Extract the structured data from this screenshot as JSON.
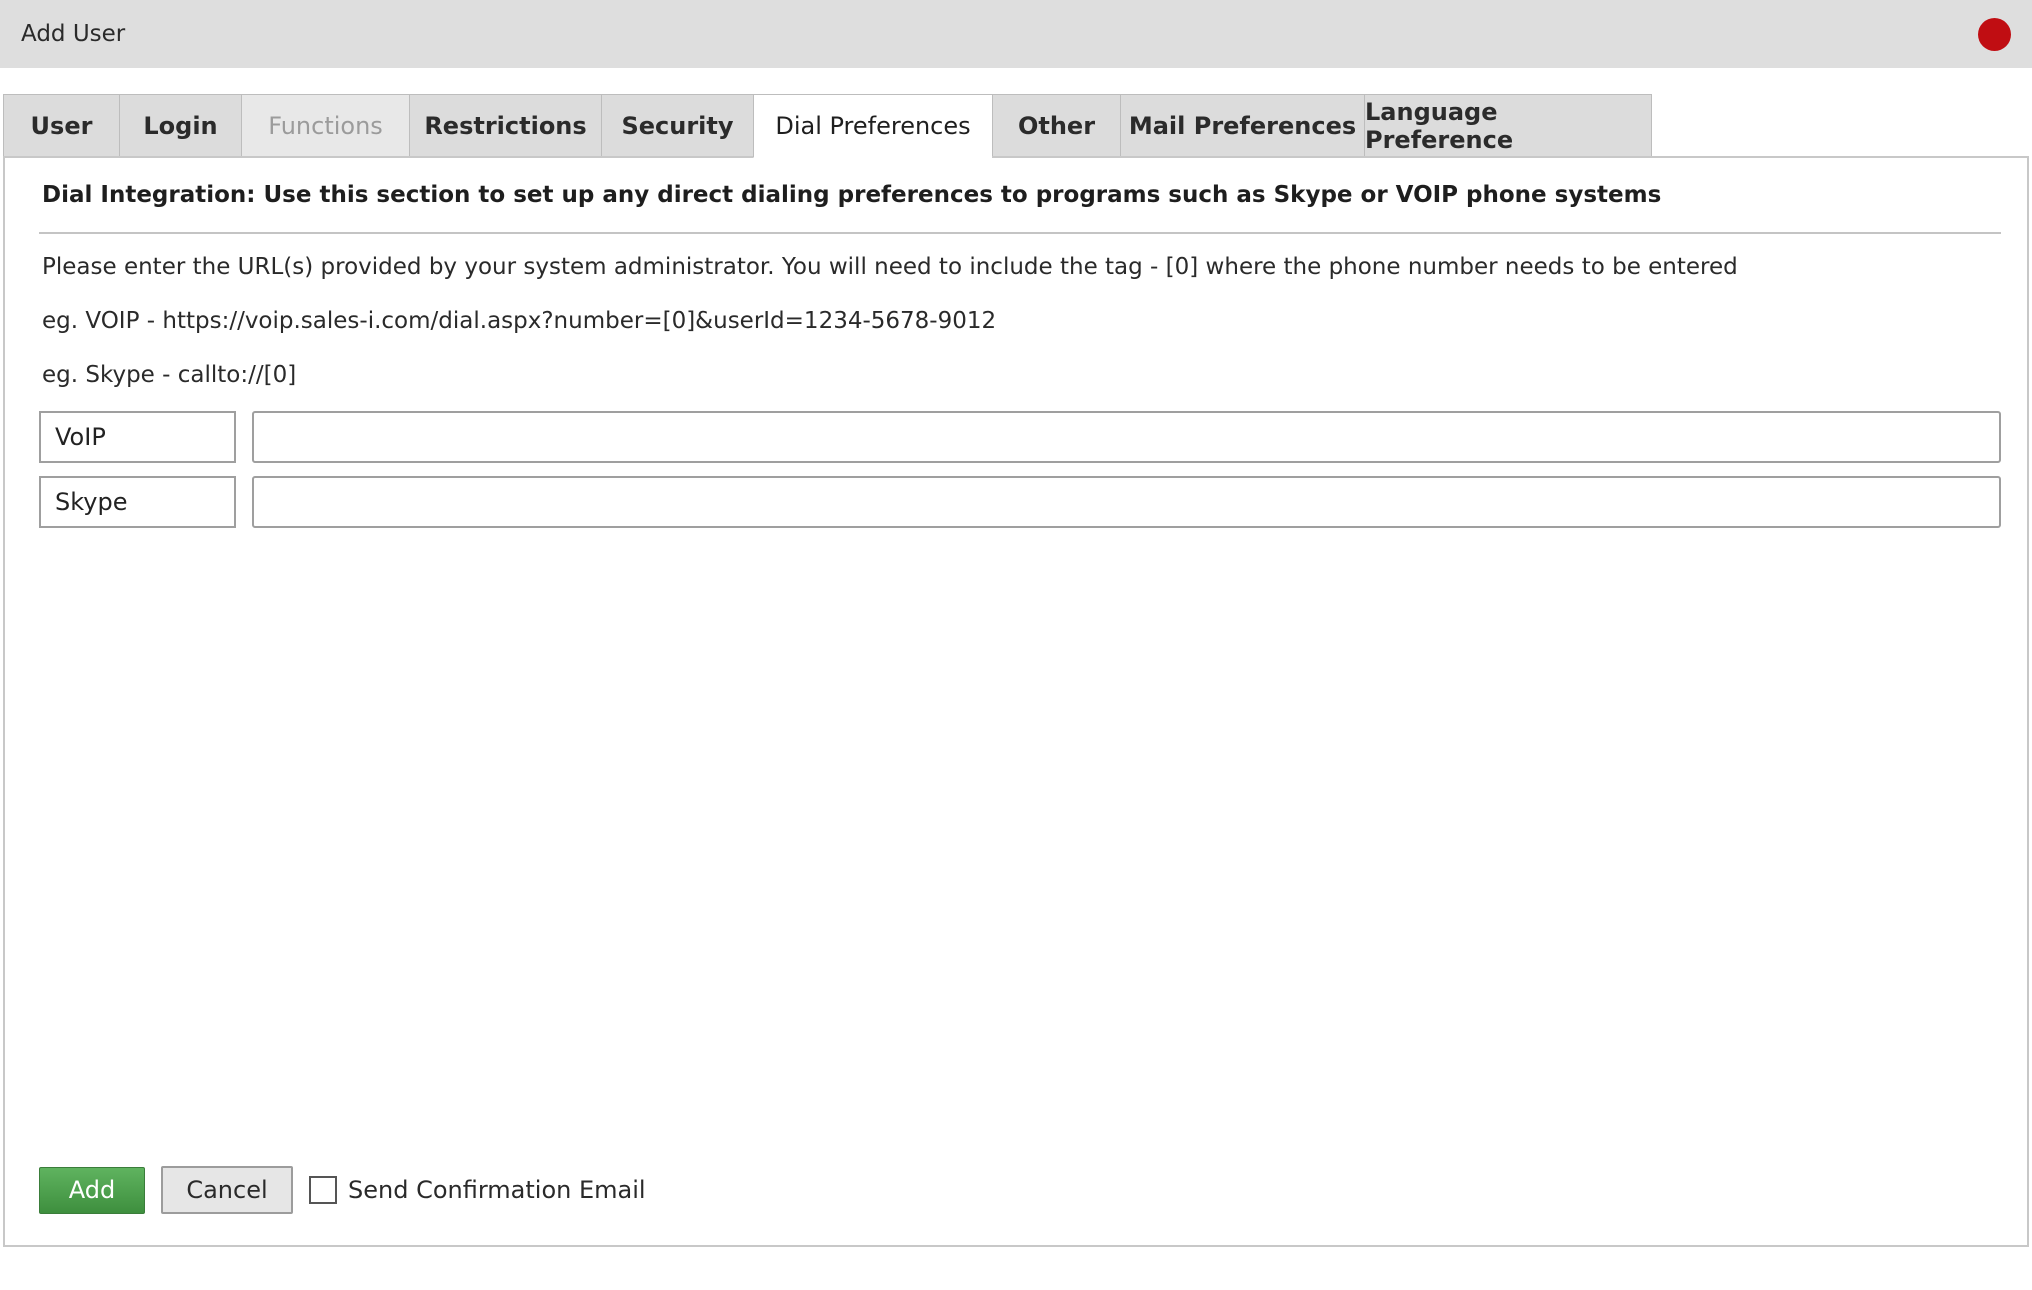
{
  "window": {
    "title": "Add User",
    "close_color": "#c00d12"
  },
  "tabs": [
    {
      "label": "User",
      "state": "normal"
    },
    {
      "label": "Login",
      "state": "normal"
    },
    {
      "label": "Functions",
      "state": "disabled"
    },
    {
      "label": "Restrictions",
      "state": "normal"
    },
    {
      "label": "Security",
      "state": "normal"
    },
    {
      "label": "Dial Preferences",
      "state": "active"
    },
    {
      "label": "Other",
      "state": "normal"
    },
    {
      "label": "Mail Preferences",
      "state": "normal"
    },
    {
      "label": "Language Preference",
      "state": "normal"
    }
  ],
  "panel": {
    "heading": "Dial Integration: Use this section to set up any direct dialing preferences to programs such as Skype or VOIP phone systems",
    "instructions": "Please enter the URL(s) provided by your system administrator. You will need to include the tag - [0] where the phone number needs to be entered",
    "example_voip": "eg. VOIP - https://voip.sales-i.com/dial.aspx?number=[0]&userId=1234-5678-9012",
    "example_skype": "eg. Skype - callto://[0]",
    "fields": [
      {
        "label": "VoIP",
        "value": ""
      },
      {
        "label": "Skype",
        "value": ""
      }
    ]
  },
  "footer": {
    "add_label": "Add",
    "cancel_label": "Cancel",
    "send_confirmation_label": "Send Confirmation Email",
    "send_confirmation_checked": false,
    "add_color": "#4a9e4a"
  }
}
